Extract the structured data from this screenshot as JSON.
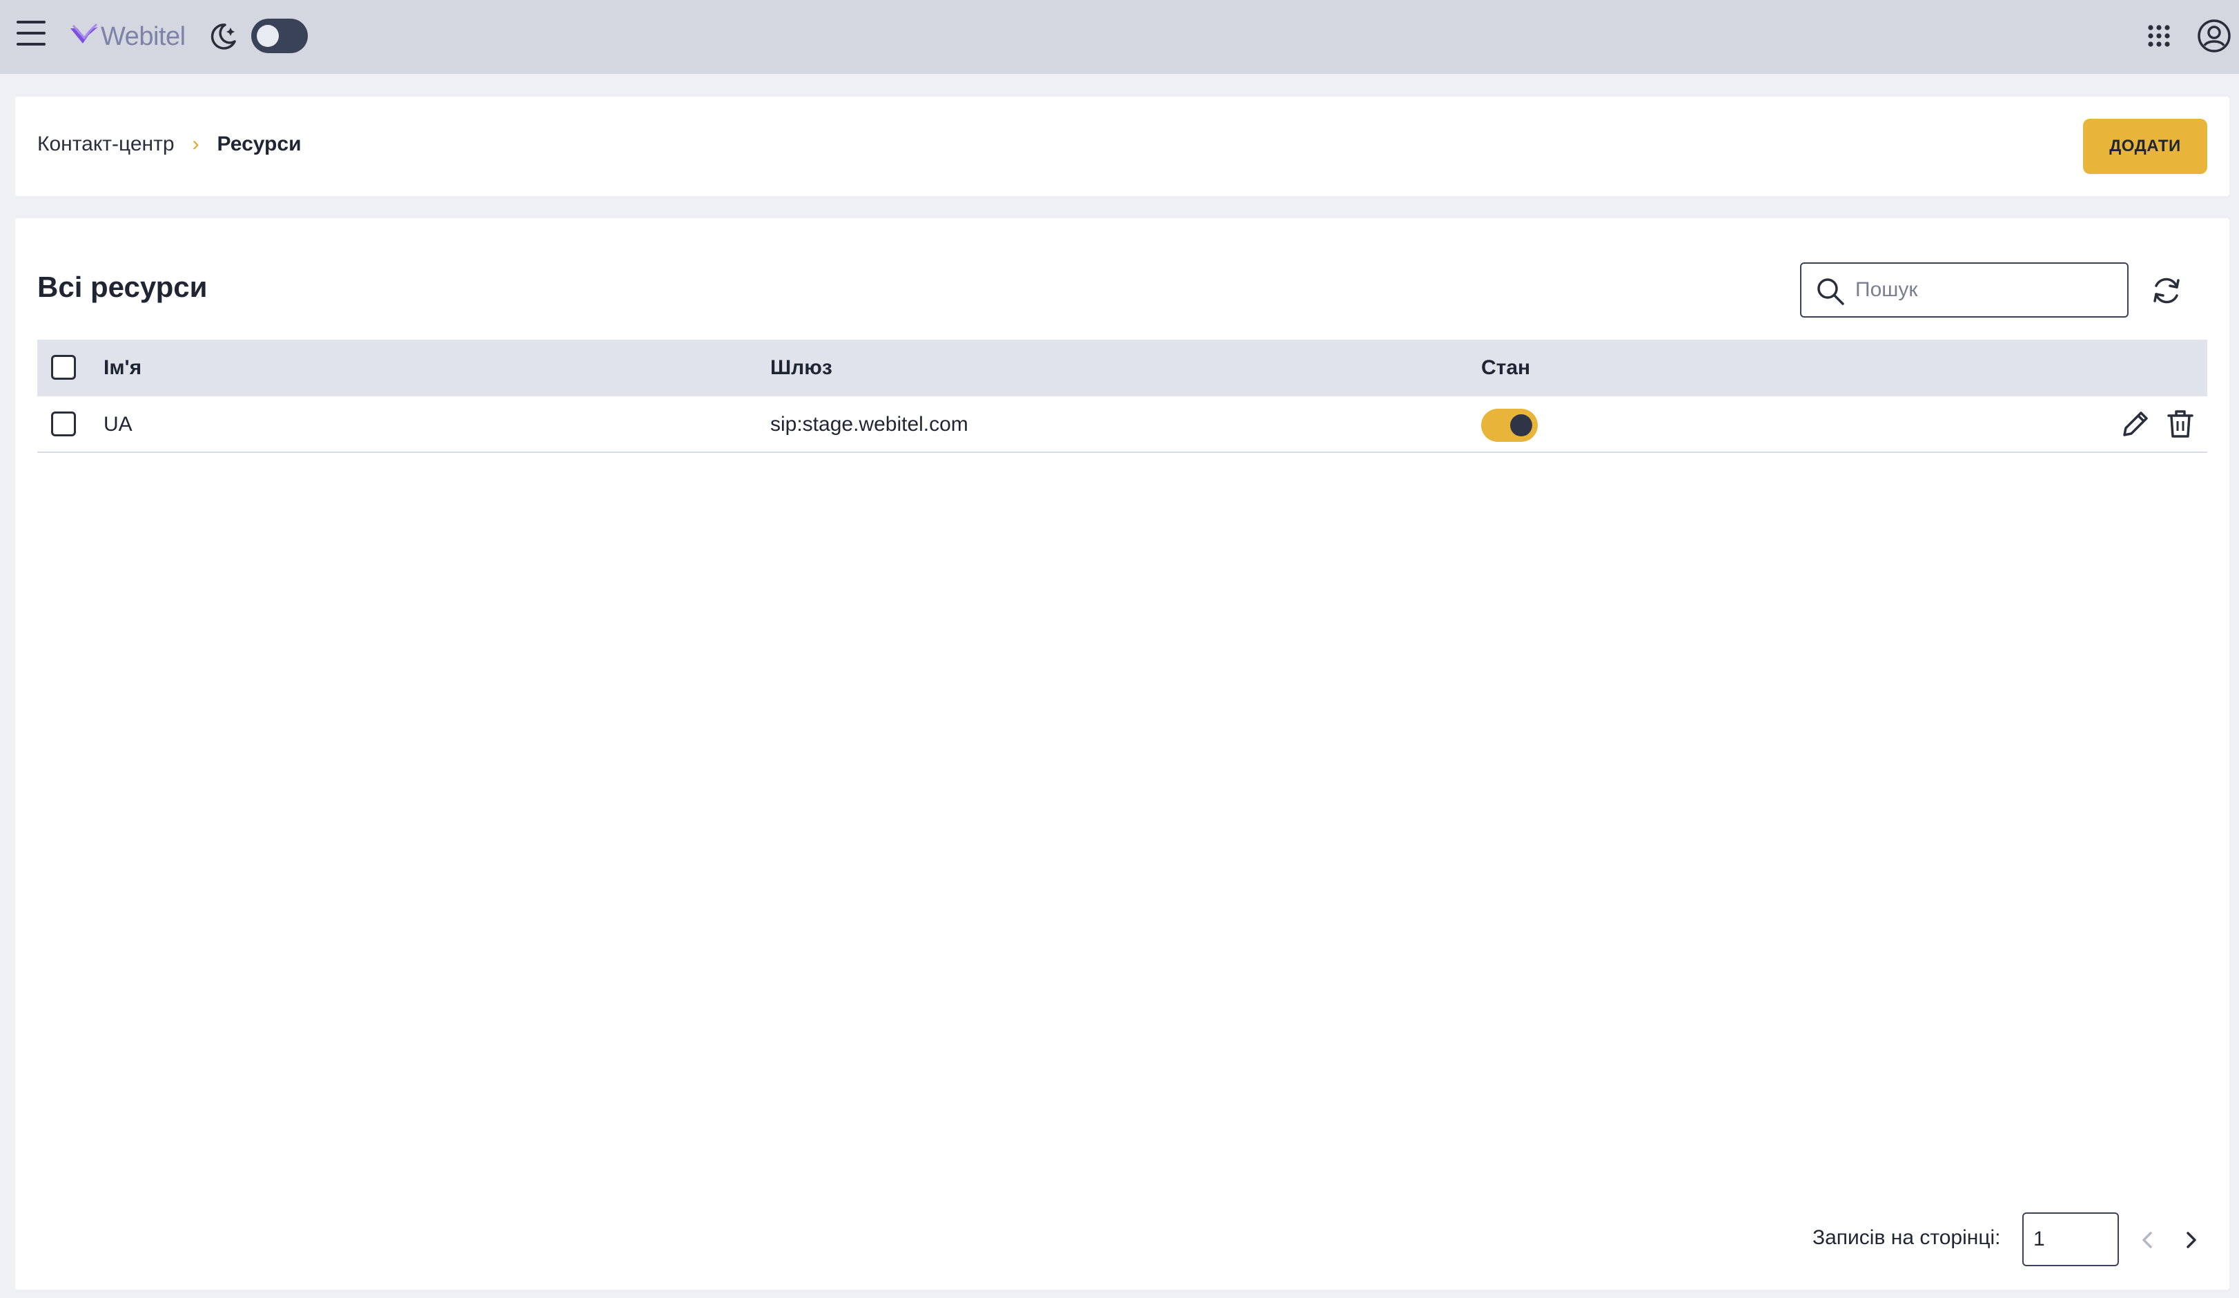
{
  "header": {
    "logo_text": "Webitel",
    "theme_toggle_on": false,
    "icons": [
      "menu-icon",
      "webitel-logo",
      "moon-icon",
      "apps-grid-icon",
      "account-icon"
    ]
  },
  "breadcrumb": {
    "parent": "Контакт-центр",
    "current": "Ресурси"
  },
  "actions": {
    "add_label": "ДОДАТИ"
  },
  "main": {
    "title": "Всі ресурси",
    "search_placeholder": "Пошук",
    "search_value": ""
  },
  "table": {
    "columns": [
      "Ім'я",
      "Шлюз",
      "Стан"
    ],
    "rows": [
      {
        "name": "UA",
        "gateway": "sip:stage.webitel.com",
        "enabled": true
      }
    ]
  },
  "pagination": {
    "per_page_label": "Записів на сторінці:",
    "per_page_value": "1"
  },
  "colors": {
    "accent": "#e9b43a",
    "topbar": "#d4d6e0",
    "header_row": "#e0e3eb",
    "dark": "#2a2e3c",
    "logo": "#7b4fe0"
  }
}
